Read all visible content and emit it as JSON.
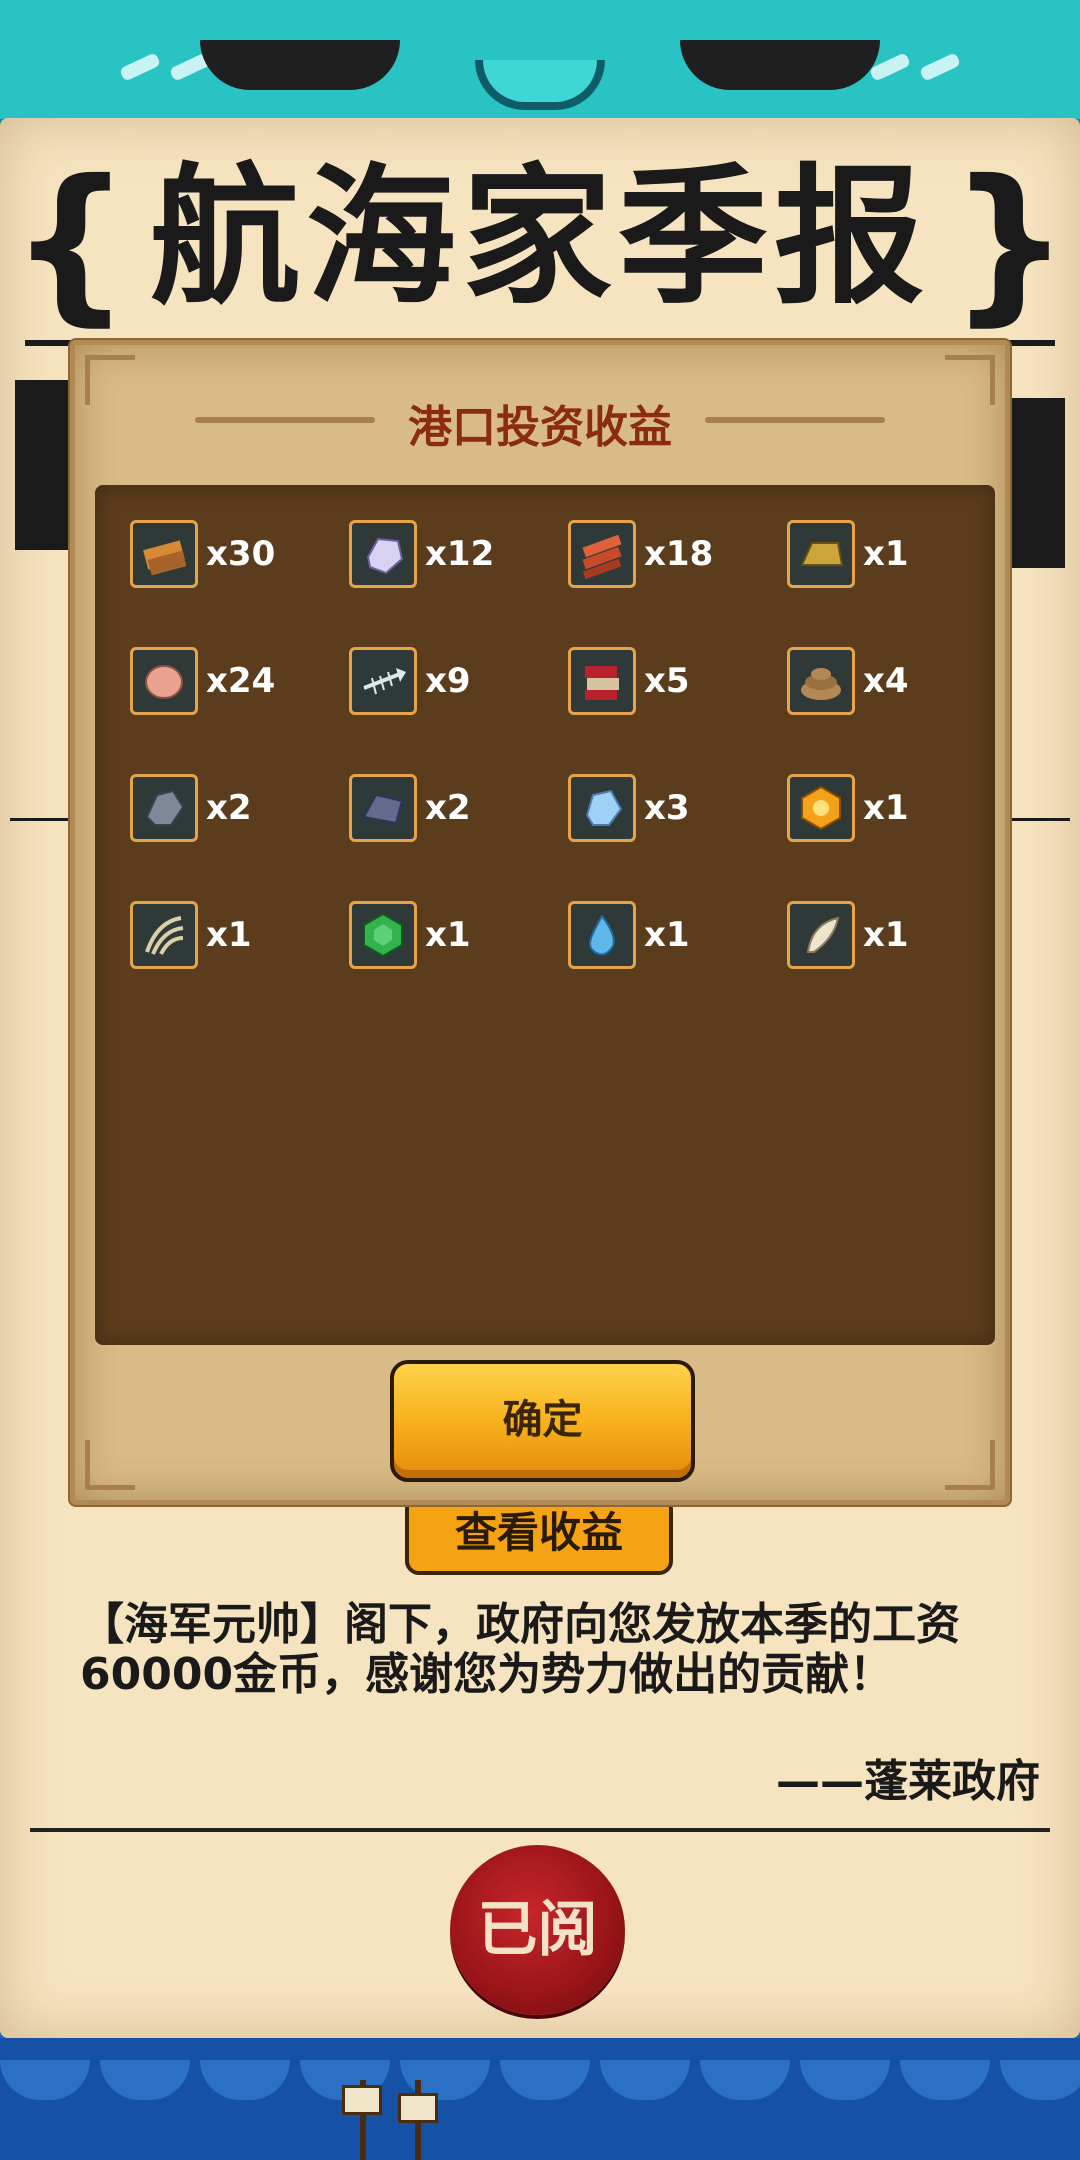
{
  "newspaper": {
    "title": "航海家季报",
    "behind_button_label": "查看收益",
    "article_text": "【海军元帅】阁下，政府向您发放本季的工资60000金币，感谢您为势力做出的贡献！",
    "signature": "——蓬莱政府",
    "seal_label": "已阅"
  },
  "dialog": {
    "title": "港口投资收益",
    "confirm_label": "确定",
    "items": [
      {
        "icon": "wood-plank-icon",
        "qty": "x30",
        "color": "#d78a35"
      },
      {
        "icon": "silver-ore-icon",
        "qty": "x12",
        "color": "#d8d2f2"
      },
      {
        "icon": "red-plank-icon",
        "qty": "x18",
        "color": "#e0603a"
      },
      {
        "icon": "gold-ingot-icon",
        "qty": "x1",
        "color": "#cca53a"
      },
      {
        "icon": "pink-stone-icon",
        "qty": "x24",
        "color": "#e9a190"
      },
      {
        "icon": "fish-bone-icon",
        "qty": "x9",
        "color": "#dfe8e8"
      },
      {
        "icon": "red-book-icon",
        "qty": "x5",
        "color": "#b7222e"
      },
      {
        "icon": "rope-coil-icon",
        "qty": "x4",
        "color": "#b48756"
      },
      {
        "icon": "iron-ore-icon",
        "qty": "x2",
        "color": "#7f8798"
      },
      {
        "icon": "iron-plate-icon",
        "qty": "x2",
        "color": "#646a8e"
      },
      {
        "icon": "ice-crystal-icon",
        "qty": "x3",
        "color": "#9fd0f5"
      },
      {
        "icon": "amber-gem-icon",
        "qty": "x1",
        "color": "#f3a21a"
      },
      {
        "icon": "claw-icon",
        "qty": "x1",
        "color": "#d9cfa9"
      },
      {
        "icon": "emerald-gem-icon",
        "qty": "x1",
        "color": "#32b34e"
      },
      {
        "icon": "water-drop-icon",
        "qty": "x1",
        "color": "#5fb7ea"
      },
      {
        "icon": "feather-icon",
        "qty": "x1",
        "color": "#efe5cf"
      }
    ]
  }
}
